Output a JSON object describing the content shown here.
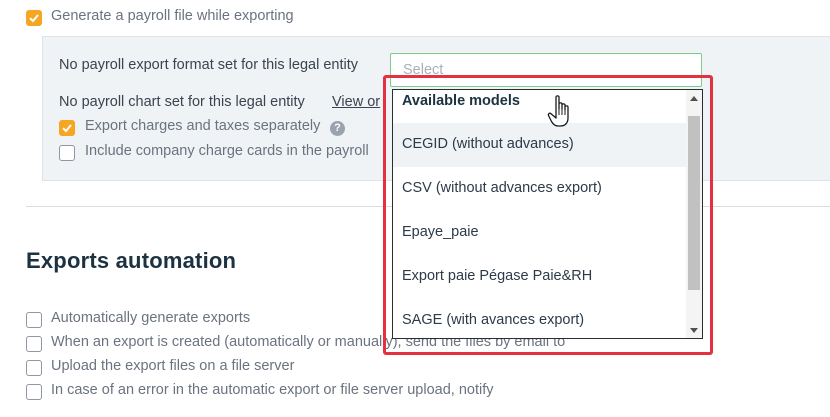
{
  "payroll": {
    "generate_label": "Generate a payroll file while exporting",
    "generate_checked": true,
    "no_format_text": "No payroll export format set for this legal entity",
    "select_placeholder": "Select",
    "no_chart_text": "No payroll chart set for this legal entity",
    "view_link": "View or",
    "export_charges_label": "Export charges and taxes separately",
    "export_charges_checked": true,
    "help_glyph": "?",
    "include_cards_label": "Include company charge cards in the payroll"
  },
  "automation": {
    "title": "Exports automation",
    "options": [
      {
        "label": "Automatically generate exports",
        "checked": false
      },
      {
        "label": "When an export is created (automatically or manually), send the files by email to",
        "checked": false
      },
      {
        "label": "Upload the export files on a file server",
        "checked": false
      },
      {
        "label": "In case of an error in the automatic export or file server upload, notify",
        "checked": false
      }
    ]
  },
  "dropdown": {
    "header": "Available models",
    "items": [
      {
        "label": "CEGID (without advances)",
        "hovered": true
      },
      {
        "label": "CSV (without advances export)",
        "hovered": false
      },
      {
        "label": "Epaye_paie",
        "hovered": false
      },
      {
        "label": "Export paie Pégase Paie&RH",
        "hovered": false
      },
      {
        "label": "SAGE (with avances export)",
        "hovered": false
      }
    ]
  },
  "colors": {
    "accent_checkbox": "#f5a623",
    "highlight_frame": "#e53040",
    "select_border": "#7ccc8e",
    "heading": "#1d3240"
  },
  "icons": {
    "cursor": "hand-pointer-icon",
    "checkmark": "checkmark-icon",
    "help": "question-mark-icon"
  }
}
